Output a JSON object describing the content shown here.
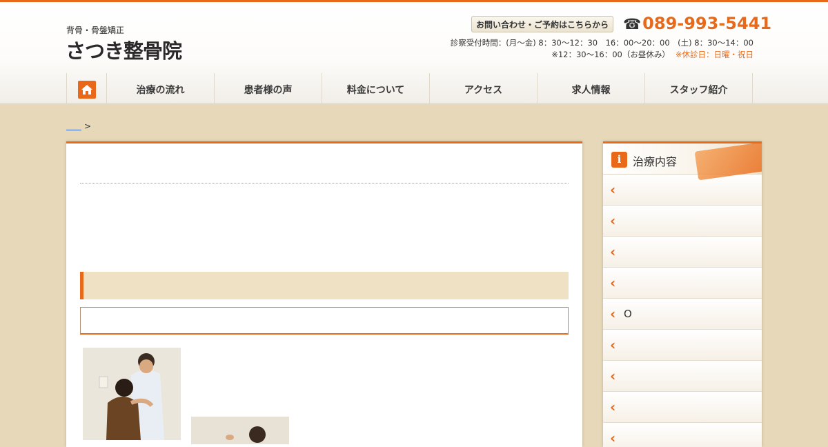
{
  "header": {
    "tagline": "背骨・骨盤矯正",
    "logo": "さつき整骨院",
    "contact_button": "お問い合わせ・ご予約はこちらから",
    "phone": "089-993-5441",
    "hours_line1": "診察受付時間：(月〜金) 8：30〜12：30　16：00〜20：00　(土) 8：30〜14：00",
    "hours_line2": "※12：30〜16：00（お昼休み）",
    "closed_days": "※休診日：日曜・祝日"
  },
  "nav": {
    "items": [
      {
        "label": "治療の流れ"
      },
      {
        "label": "患者様の声"
      },
      {
        "label": "料金について"
      },
      {
        "label": "アクセス"
      },
      {
        "label": "求人情報"
      },
      {
        "label": "スタッフ紹介"
      }
    ]
  },
  "breadcrumb": {
    "separator": ">"
  },
  "sidebar": {
    "title": "治療内容",
    "items": [
      {
        "label": ""
      },
      {
        "label": ""
      },
      {
        "label": ""
      },
      {
        "label": ""
      },
      {
        "label": "O"
      },
      {
        "label": ""
      },
      {
        "label": ""
      },
      {
        "label": ""
      },
      {
        "label": ""
      }
    ]
  },
  "colors": {
    "accent": "#e8691a",
    "background": "#e6d8b8",
    "heading_bar": "#efe1c3"
  }
}
